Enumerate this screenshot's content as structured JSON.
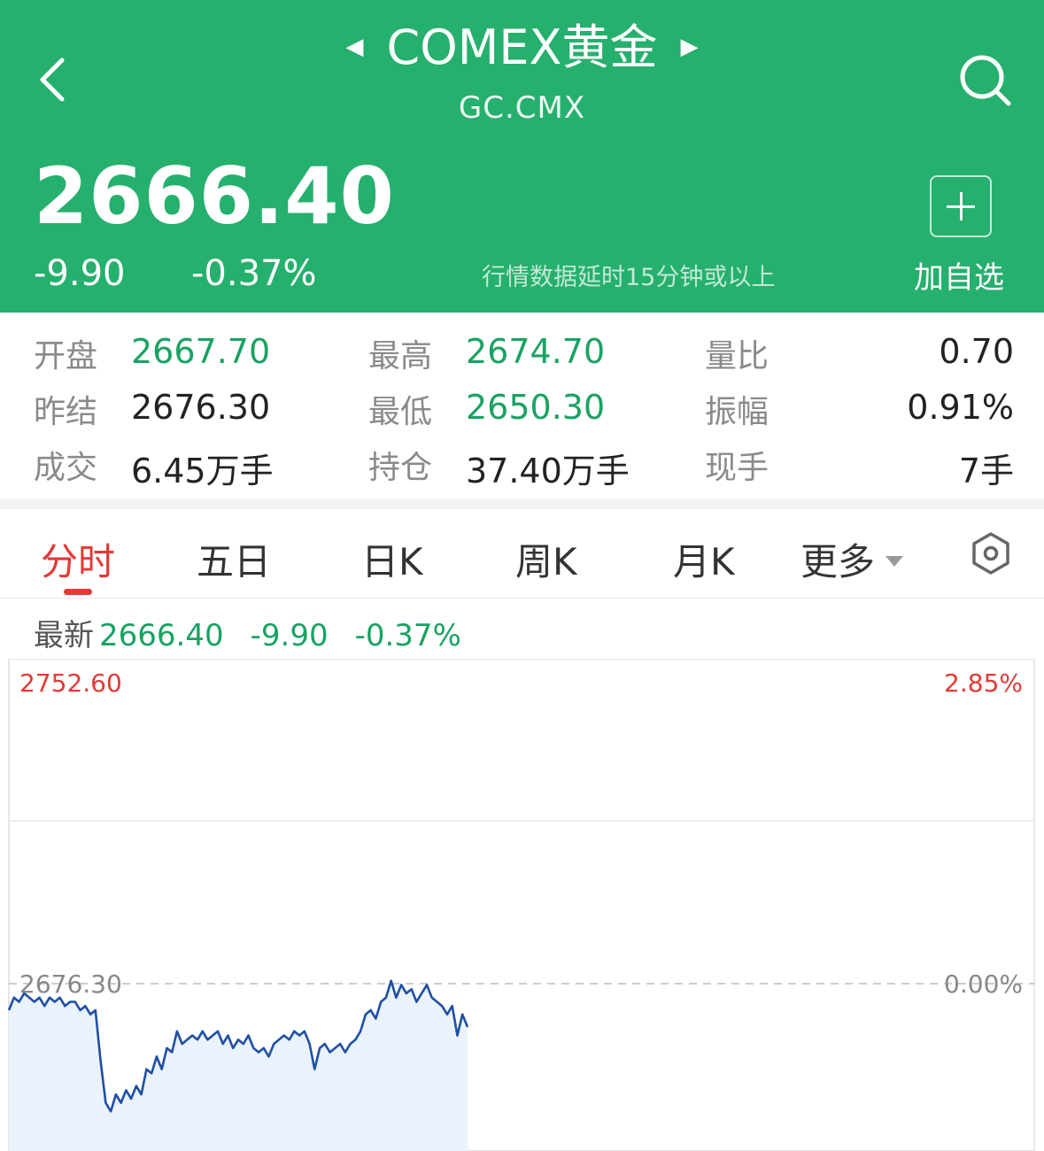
{
  "header": {
    "title": "COMEX黄金",
    "prev_icon": "caret-left-icon",
    "next_icon": "caret-right-icon",
    "code": "GC.CMX",
    "price": "2666.40",
    "change": "-9.90",
    "change_pct": "-0.37%",
    "delay_note": "行情数据延时15分钟或以上",
    "add_label": "加自选",
    "bg_color": "#25b06d"
  },
  "stats": {
    "col1": [
      {
        "label": "开盘",
        "value": "2667.70"
      },
      {
        "label": "昨结",
        "value": "2676.30"
      },
      {
        "label": "成交",
        "value": "6.45万手"
      }
    ],
    "col2": [
      {
        "label": "最高",
        "value": "2674.70"
      },
      {
        "label": "最低",
        "value": "2650.30"
      },
      {
        "label": "持仓",
        "value": "37.40万手"
      }
    ],
    "col3": [
      {
        "label": "量比",
        "value": "0.70"
      },
      {
        "label": "振幅",
        "value": "0.91%"
      },
      {
        "label": "现手",
        "value": "7手"
      }
    ]
  },
  "tabs": [
    {
      "label": "分时"
    },
    {
      "label": "五日"
    },
    {
      "label": "日K"
    },
    {
      "label": "周K"
    },
    {
      "label": "月K"
    },
    {
      "label": "更多"
    }
  ],
  "latest": {
    "label": "最新",
    "price": "2666.40",
    "change": "-9.90",
    "pct": "-0.37%"
  },
  "chart_data": {
    "type": "area",
    "y_max_label": "2752.60",
    "y_max_pct": "2.85%",
    "ref_label": "2676.30",
    "ref_pct": "0.00%",
    "ylim": [
      2600.0,
      2752.6
    ],
    "reference": 2676.3,
    "line_color": "#1f4fa3",
    "fill_color": "#eaf2fb",
    "up_color": "#e53935",
    "series": [
      {
        "values": [
          2670,
          2673,
          2672,
          2674,
          2673,
          2672,
          2673,
          2671,
          2673,
          2672,
          2673,
          2671,
          2672,
          2672,
          2670,
          2671,
          2669,
          2670,
          2658,
          2648,
          2646,
          2650,
          2648,
          2651,
          2649,
          2652,
          2650,
          2656,
          2655,
          2659,
          2656,
          2661,
          2660,
          2665,
          2662,
          2663,
          2664,
          2663,
          2665,
          2663,
          2664,
          2665,
          2662,
          2664,
          2661,
          2663,
          2662,
          2664,
          2661,
          2660,
          2661,
          2659,
          2662,
          2663,
          2664,
          2663,
          2665,
          2664,
          2665,
          2662,
          2656,
          2661,
          2662,
          2660,
          2661,
          2662,
          2660,
          2662,
          2663,
          2665,
          2669,
          2670,
          2668,
          2672,
          2673,
          2677,
          2673,
          2676,
          2674,
          2675,
          2672,
          2674,
          2676,
          2673,
          2672,
          2671,
          2669,
          2671,
          2664,
          2669,
          2666
        ]
      }
    ]
  },
  "icons": {
    "back": "back-arrow-icon",
    "search": "search-icon",
    "add": "plus-icon",
    "settings": "hexagon-settings-icon"
  }
}
